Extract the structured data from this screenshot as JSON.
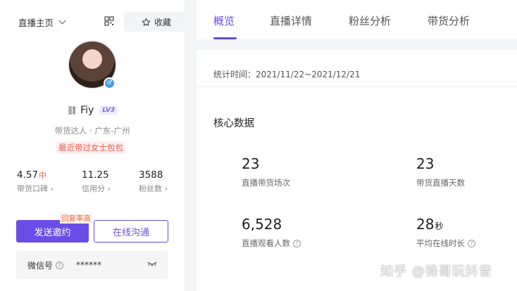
{
  "sidebar": {
    "home_select": "直播主页",
    "favorite_label": "收藏",
    "profile": {
      "name": "Fiy",
      "level": "LV3",
      "role": "带货达人 · 广东-广州",
      "recent_tag": "最近带过女士包包",
      "gender_symbol": "♂"
    },
    "stats": [
      {
        "value": "4.57",
        "tag": "中",
        "label": "带货口碑 ›"
      },
      {
        "value": "11.25",
        "tag": "",
        "label": "信用分 ›"
      },
      {
        "value": "3588",
        "tag": "",
        "label": "粉丝数 ›"
      }
    ],
    "reply_hint": "回复率高",
    "invite_label": "发送邀约",
    "chat_label": "在线沟通",
    "wechat": {
      "label": "微信号",
      "value": "******"
    }
  },
  "tabs": [
    {
      "label": "概览",
      "active": true
    },
    {
      "label": "直播详情",
      "active": false
    },
    {
      "label": "粉丝分析",
      "active": false
    },
    {
      "label": "带货分析",
      "active": false
    }
  ],
  "overview": {
    "period": "统计时间：2021/11/22~2021/12/21",
    "core_title": "核心数据",
    "metrics": [
      {
        "value": "23",
        "unit": "",
        "label": "直播带货场次",
        "help": false
      },
      {
        "value": "23",
        "unit": "",
        "label": "带货直播天数",
        "help": false
      },
      {
        "value": "6,528",
        "unit": "",
        "label": "直播观看人数",
        "help": true
      },
      {
        "value": "28",
        "unit": "秒",
        "label": "平均在线时长",
        "help": true
      }
    ]
  },
  "watermark": "知乎 @锋哥玩抖音",
  "colors": {
    "accent": "#6a4ce6",
    "warning": "#f05a4e"
  }
}
